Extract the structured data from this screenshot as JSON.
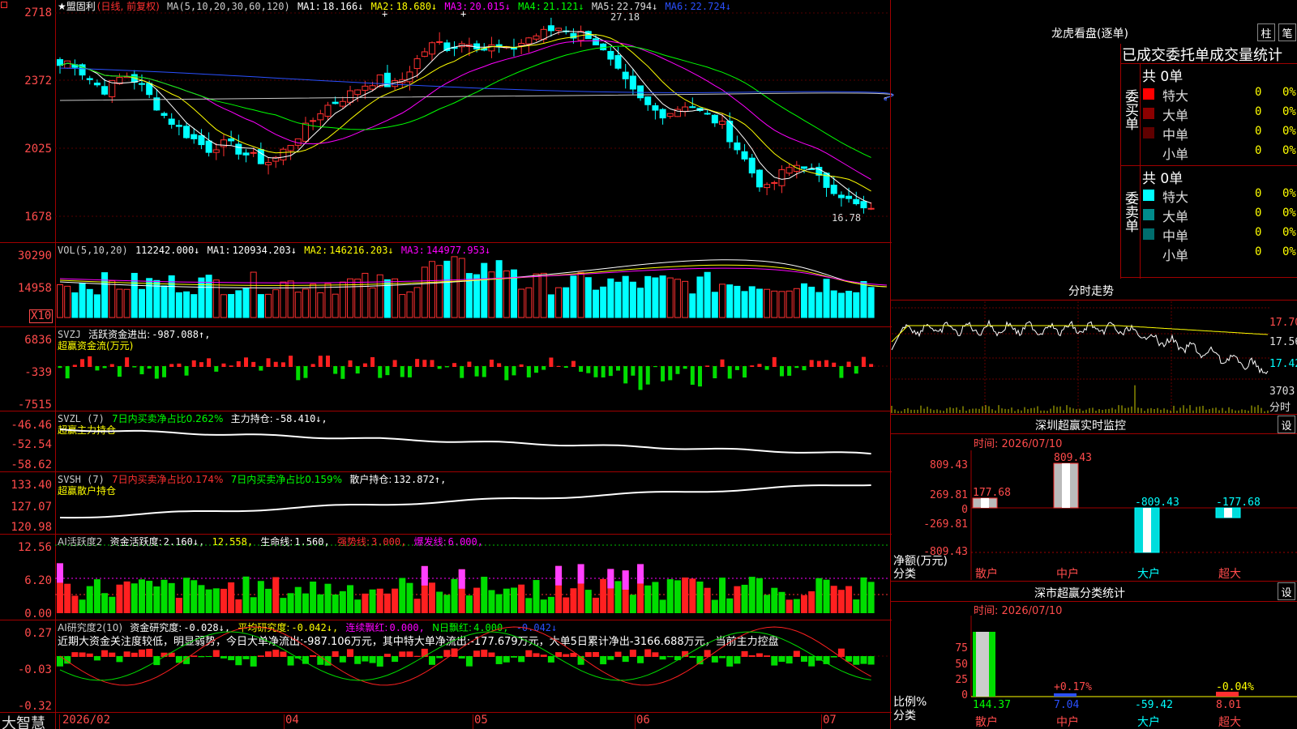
{
  "stock": {
    "title_prefix": "★盟固利",
    "mode": "(日线, 前复权)",
    "ma_title": "MA(5,10,20,30,60,120)",
    "ma": [
      {
        "label": "MA1:",
        "value": "18.166↓",
        "color": "#ffffff"
      },
      {
        "label": "MA2:",
        "value": "18.680↓",
        "color": "#ffff00"
      },
      {
        "label": "MA3:",
        "value": "20.015↓",
        "color": "#ff00ff"
      },
      {
        "label": "MA4:",
        "value": "21.121↓",
        "color": "#00ff00"
      },
      {
        "label": "MA5:",
        "value": "22.794↓",
        "color": "#c8c8c8"
      },
      {
        "label": "MA6:",
        "value": "22.724↓",
        "color": "#2a50ff"
      }
    ],
    "y_labels": [
      "2718",
      "2372",
      "2025",
      "1678"
    ],
    "high_label": "27.18",
    "low_label": "16.78"
  },
  "vol": {
    "title": "VOL(5,10,20)",
    "value": "112242.000↓",
    "ma": [
      {
        "label": "MA1:",
        "value": "120934.203↓",
        "color": "#ffffff"
      },
      {
        "label": "MA2:",
        "value": "146216.203↓",
        "color": "#ffff00"
      },
      {
        "label": "MA3:",
        "value": "144977.953↓",
        "color": "#ff00ff"
      }
    ],
    "y_labels": [
      "30290",
      "14958"
    ],
    "unit": "X10"
  },
  "svzj": {
    "title": "SVZJ",
    "label": "活跃资金进出:",
    "value": "-987.088↑,",
    "sub": "超赢资金流(万元)",
    "y_labels": [
      "6836",
      "-339",
      "-7515"
    ]
  },
  "svzl": {
    "title": "SVZL (7)",
    "label1": "7日内买卖净占比0.262%",
    "label2": "主力持仓:",
    "value": "-58.410↓,",
    "sub": "超赢主力持仓",
    "y_labels": [
      "-46.46",
      "-52.54",
      "-58.62"
    ]
  },
  "svsh": {
    "title": "SVSH (7)",
    "label1": "7日内买卖净占比0.174%",
    "label2": "7日内买卖净占比0.159%",
    "label3": "散户持仓:",
    "value": "132.872↑,",
    "sub": "超赢散户持仓",
    "y_labels": [
      "133.40",
      "127.07",
      "120.98"
    ]
  },
  "ai1": {
    "title": "AI活跃度2",
    "label": "资金活跃度:",
    "v1": "2.160↓,",
    "v2": "12.558,",
    "l3": "生命线:",
    "v3": "1.560,",
    "l4": "强势线:",
    "v4": "3.000,",
    "l5": "爆发线:",
    "v5": "6.000,",
    "y_labels": [
      "12.56",
      "6.20",
      "0.00"
    ]
  },
  "ai2": {
    "title": "AI研究度2(10)",
    "l1": "资金研究度:",
    "v1": "-0.028↓,",
    "l2": "平均研究度:",
    "v2": "-0.042↓,",
    "l3": "连续飘红:",
    "v3": "0.000,",
    "l4": "N日飘红:",
    "v4": "4.000,",
    "v5": "-0.042↓",
    "comment": "近期大资金关注度较低，明显弱势，今日大单净流出:-987.106万元，其中特大单净流出:-177.679万元，大单5日累计净出-3166.688万元，当前主力控盘",
    "y_labels": [
      "0.27",
      "-0.03",
      "-0.32"
    ]
  },
  "x_labels": [
    "2026/02",
    "04",
    "05",
    "06",
    "07"
  ],
  "brand": "大智慧",
  "right": {
    "dragon_title": "龙虎看盘(逐单)",
    "btn_bar": "柱",
    "btn_bi": "笔",
    "stat_title": "已成交委托单成交量统计",
    "buy_vert": "委买单",
    "sell_vert": "委卖单",
    "buy_total": "共 0单",
    "sell_total": "共 0单",
    "buy_rows": [
      {
        "label": "特大",
        "count": "0",
        "pct": "0%",
        "color": "#ff0000"
      },
      {
        "label": "大单",
        "count": "0",
        "pct": "0%",
        "color": "#8b0000"
      },
      {
        "label": "中单",
        "count": "0",
        "pct": "0%",
        "color": "#600000"
      },
      {
        "label": "小单",
        "count": "0",
        "pct": "0%",
        "color": "#000000"
      }
    ],
    "sell_rows": [
      {
        "label": "特大",
        "count": "0",
        "pct": "0%",
        "color": "#00ffff"
      },
      {
        "label": "大单",
        "count": "0",
        "pct": "0%",
        "color": "#008b8b"
      },
      {
        "label": "中单",
        "count": "0",
        "pct": "0%",
        "color": "#006d6d"
      },
      {
        "label": "小单",
        "count": "0",
        "pct": "0%",
        "color": "#000000"
      }
    ],
    "intraday_title": "分时走势",
    "intraday_prices": [
      "17.70",
      "17.56",
      "17.42"
    ],
    "intraday_vol": "3703",
    "intraday_unit": "分时",
    "monitor_title": "深圳超赢实时监控",
    "monitor_time": "时间: 2026/07/10",
    "monitor_y": [
      "809.43",
      "269.81",
      "0",
      "-269.81",
      "-809.43"
    ],
    "monitor_unit": "净额(万元)",
    "monitor_axis": "分类",
    "monitor_cats": [
      "散户",
      "中户",
      "大户",
      "超大"
    ],
    "monitor_vals": [
      177.68,
      809.43,
      -809.43,
      -177.68
    ],
    "monitor_val_labels": [
      "177.68",
      "809.43",
      "-809.43",
      "-177.68"
    ],
    "btn_set": "设",
    "stat2_title": "深市超赢分类统计",
    "stat2_time": "时间: 2026/07/10",
    "stat2_y": [
      "75",
      "50",
      "25",
      "0"
    ],
    "stat2_unit": "比例%",
    "stat2_axis": "分类",
    "stat2_cats": [
      "散户",
      "中户",
      "大户",
      "超大"
    ],
    "stat2_vals": [
      144.37,
      7.04,
      -59.42,
      8.01
    ],
    "stat2_val_labels": [
      "144.37",
      "7.04",
      "-59.42",
      "8.01"
    ],
    "stat2_pct_labels": [
      "+0.17%",
      "-0.04%"
    ]
  }
}
